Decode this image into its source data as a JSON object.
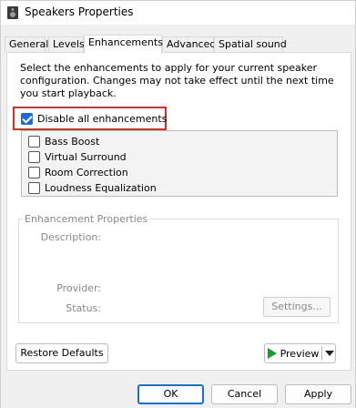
{
  "window": {
    "title": "Speakers Properties"
  },
  "tabs": [
    {
      "label": "General",
      "active": false
    },
    {
      "label": "Levels",
      "active": false
    },
    {
      "label": "Enhancements",
      "active": true
    },
    {
      "label": "Advanced",
      "active": false
    },
    {
      "label": "Spatial sound",
      "active": false
    }
  ],
  "enhancements": {
    "description": "Select the enhancements to apply for your current speaker configuration. Changes may not take effect until the next time you start playback.",
    "disable_all": {
      "label": "Disable all enhancements",
      "checked": true
    },
    "items": [
      {
        "label": "Bass Boost",
        "checked": false
      },
      {
        "label": "Virtual Surround",
        "checked": false
      },
      {
        "label": "Room Correction",
        "checked": false
      },
      {
        "label": "Loudness Equalization",
        "checked": false
      }
    ]
  },
  "properties": {
    "title": "Enhancement Properties",
    "description_label": "Description:",
    "provider_label": "Provider:",
    "status_label": "Status:",
    "settings_label": "Settings..."
  },
  "buttons": {
    "restore_defaults": "Restore Defaults",
    "preview": "Preview",
    "ok": "OK",
    "cancel": "Cancel",
    "apply": "Apply"
  },
  "colors": {
    "highlight": "#d92d2d",
    "accent": "#1f6bd1",
    "play": "#1e9a2e"
  }
}
